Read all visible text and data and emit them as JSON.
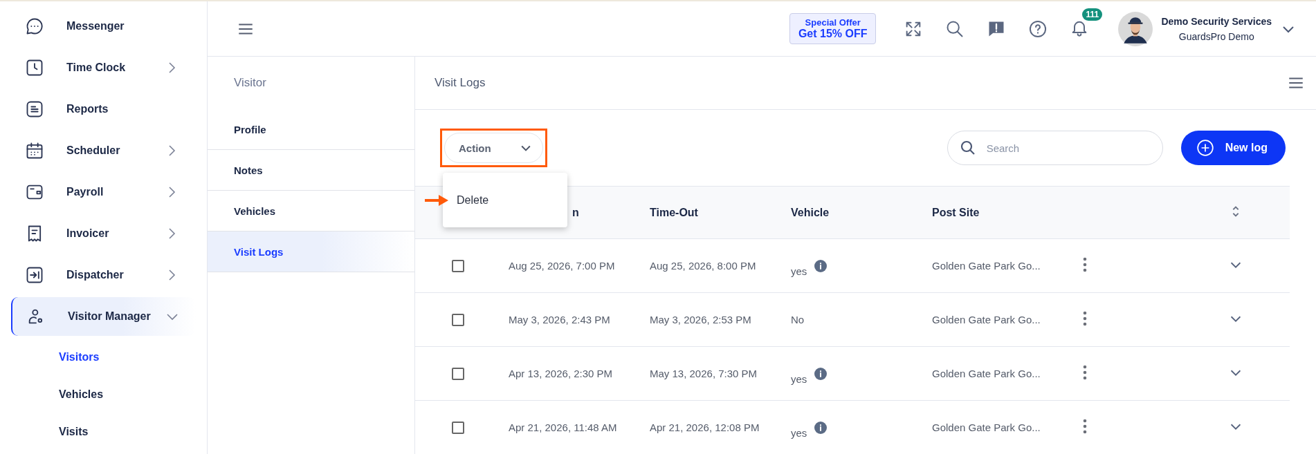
{
  "sidebar": {
    "items": [
      {
        "label": "Messenger",
        "kind": "link",
        "selected": false
      },
      {
        "label": "Time Clock",
        "kind": "group",
        "expanded": false,
        "selected": false
      },
      {
        "label": "Reports",
        "kind": "link",
        "selected": false
      },
      {
        "label": "Scheduler",
        "kind": "group",
        "expanded": false,
        "selected": false
      },
      {
        "label": "Payroll",
        "kind": "group",
        "expanded": false,
        "selected": false
      },
      {
        "label": "Invoicer",
        "kind": "group",
        "expanded": false,
        "selected": false
      },
      {
        "label": "Dispatcher",
        "kind": "group",
        "expanded": false,
        "selected": false
      },
      {
        "label": "Visitor Manager",
        "kind": "group",
        "expanded": true,
        "selected": true,
        "children": [
          {
            "label": "Visitors",
            "selected": true
          },
          {
            "label": "Vehicles",
            "selected": false
          },
          {
            "label": "Visits",
            "selected": false
          }
        ]
      }
    ]
  },
  "topbar": {
    "offer": {
      "line_1": "Special Offer",
      "line_2": "Get 15% OFF"
    },
    "notifications": "111",
    "user": {
      "name": "Demo Security Services",
      "company": "GuardsPro Demo"
    }
  },
  "subnav": {
    "title": "Visitor",
    "items": [
      {
        "label": "Profile",
        "selected": false
      },
      {
        "label": "Notes",
        "selected": false
      },
      {
        "label": "Vehicles",
        "selected": false
      },
      {
        "label": "Visit Logs",
        "selected": true
      }
    ]
  },
  "page_title": "Visit Logs",
  "action": {
    "label": "Action",
    "highlighted": true,
    "menu": [
      {
        "label": "Delete",
        "pointed": true
      }
    ]
  },
  "search": {
    "placeholder": "Search"
  },
  "new_button": "New log",
  "table": {
    "columns": [
      "n",
      "Time-Out",
      "Vehicle",
      "Post Site"
    ],
    "rows": [
      {
        "checked": false,
        "time_in": "Aug 25, 2026, 7:00 PM",
        "time_out": "Aug 25, 2026, 8:00 PM",
        "vehicle": "yes",
        "info": true,
        "post_site": "Golden Gate Park Go..."
      },
      {
        "checked": false,
        "time_in": "May 3, 2026, 2:43 PM",
        "time_out": "May 3, 2026, 2:53 PM",
        "vehicle": "No",
        "info": false,
        "post_site": "Golden Gate Park Go..."
      },
      {
        "checked": false,
        "time_in": "Apr 13, 2026, 2:30 PM",
        "time_out": "May 13, 2026, 7:30 PM",
        "vehicle": "yes",
        "info": true,
        "post_site": "Golden Gate Park Go..."
      },
      {
        "checked": false,
        "time_in": "Apr 21, 2026, 11:48 AM",
        "time_out": "Apr 21, 2026, 12:08 PM",
        "vehicle": "yes",
        "info": true,
        "post_site": "Golden Gate Park Go..."
      }
    ]
  }
}
